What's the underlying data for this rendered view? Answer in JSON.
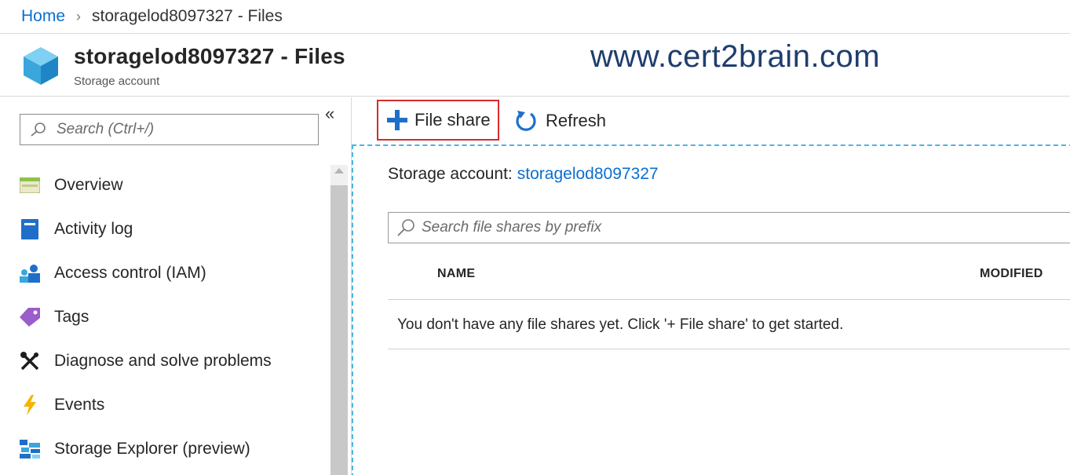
{
  "breadcrumb": {
    "home": "Home",
    "current": "storagelod8097327 - Files"
  },
  "header": {
    "title": "storagelod8097327 - Files",
    "subtitle": "Storage account",
    "watermark": "www.cert2brain.com"
  },
  "sidebar": {
    "search_placeholder": "Search (Ctrl+/)",
    "collapse_label": "«",
    "items": [
      {
        "label": "Overview",
        "icon": "overview-icon"
      },
      {
        "label": "Activity log",
        "icon": "activity-log-icon"
      },
      {
        "label": "Access control (IAM)",
        "icon": "access-control-icon"
      },
      {
        "label": "Tags",
        "icon": "tag-icon"
      },
      {
        "label": "Diagnose and solve problems",
        "icon": "wrench-icon"
      },
      {
        "label": "Events",
        "icon": "lightning-icon"
      },
      {
        "label": "Storage Explorer (preview)",
        "icon": "storage-explorer-icon"
      }
    ]
  },
  "toolbar": {
    "file_share_label": "File share",
    "refresh_label": "Refresh"
  },
  "main": {
    "account_label": "Storage account:",
    "account_link": "storagelod8097327",
    "search_placeholder": "Search file shares by prefix",
    "columns": [
      "NAME",
      "MODIFIED"
    ],
    "empty_message": "You don't have any file shares yet. Click '+ File share' to get started."
  },
  "colors": {
    "link": "#0a6fd0",
    "highlight_border": "#d52b2b",
    "selection_dash": "#4fb3e0",
    "watermark": "#1f3e6e"
  }
}
